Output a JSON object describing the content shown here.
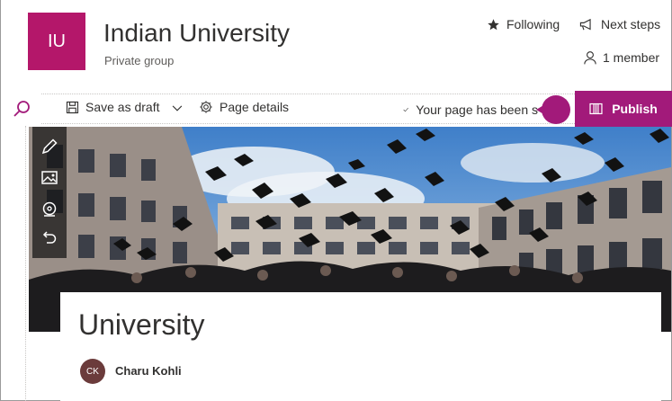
{
  "site": {
    "logo_initials": "IU",
    "title": "Indian University",
    "subtitle": "Private group",
    "logo_color": "#b4176a"
  },
  "header_actions": {
    "following": "Following",
    "next_steps": "Next steps",
    "members": "1 member"
  },
  "command_bar": {
    "save_draft": "Save as draft",
    "page_details": "Page details",
    "status": "Your page has been s",
    "publish": "Publish",
    "accent_color": "#a21a7a"
  },
  "toolbox": {
    "icons": [
      "edit-icon",
      "change-image-icon",
      "focal-point-icon",
      "reset-icon"
    ]
  },
  "page": {
    "title": "University",
    "author_initials": "CK",
    "author_name": "Charu Kohli"
  }
}
